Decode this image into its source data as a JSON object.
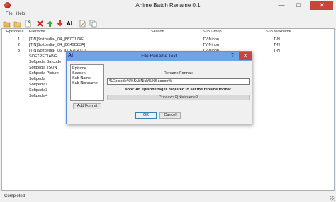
{
  "window": {
    "title": "Anime Batch Rename 0.1",
    "minimize": "—",
    "maximize": "□",
    "close": "✕"
  },
  "menu": [
    "File",
    "Help"
  ],
  "toolbar": [
    "open-folder-icon",
    "folder-icon",
    "new-file-icon",
    "delete-icon",
    "move-up-icon",
    "move-down-icon",
    "rename-text-icon",
    "edit-icon",
    "copy-icon"
  ],
  "toolbar_ai_label": "AI",
  "list": {
    "columns": [
      "Episode #",
      "Filename",
      "Season",
      "Sub Group",
      "Sub Nickname"
    ],
    "rows": [
      [
        "1",
        "[T-N]Softpedia-_04_[887C174E]",
        "",
        "TV-Nihon",
        "T-N"
      ],
      [
        "2",
        "[T-N]Softpedia-_04_[0C49D83A]",
        "",
        "TV-Nihon",
        "T-N"
      ],
      [
        "3",
        "[T-N]Softpedia-_06_[D1F7C41C]",
        "",
        "TV-Nihon",
        "T-N"
      ],
      [
        "",
        "SOFTPEDIABG",
        "",
        "",
        ""
      ],
      [
        "",
        "Softpedia Barcode",
        "",
        "",
        ""
      ],
      [
        "",
        "Softpedia JSON",
        "",
        "",
        ""
      ],
      [
        "",
        "Softpedia Picture",
        "",
        "",
        ""
      ],
      [
        "",
        "Softpedia",
        "",
        "",
        ""
      ],
      [
        "",
        "Softpedia1",
        "",
        "",
        ""
      ],
      [
        "",
        "Softpedia3",
        "",
        "",
        ""
      ],
      [
        "",
        "Softpedia4",
        "",
        "",
        ""
      ]
    ]
  },
  "status": "Completed",
  "dialog": {
    "icon": "AI",
    "title": "File Rename Text",
    "help": "?",
    "close": "✕",
    "tags": [
      "Episode",
      "Season",
      "Sub Name",
      "Sub Nickname"
    ],
    "add_format": "Add Format",
    "format_label": "Rename Format:",
    "format_value": "%Episode%%SubNick%%Season%",
    "note": "Note: An episode tag is required to set the rename format.",
    "preview": "Preview: 0)Nickname2",
    "ok": "OK",
    "cancel": "Cancel"
  }
}
